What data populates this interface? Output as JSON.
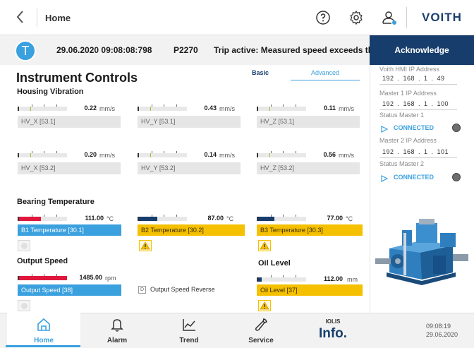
{
  "header": {
    "back_icon": "chevron-left-icon",
    "title": "Home",
    "brand": "VOITH"
  },
  "alarm": {
    "icon_letter": "T",
    "timestamp": "29.06.2020 09:08:08:798",
    "code": "P2270",
    "message": "Trip active: Measured speed exceeds th",
    "acknowledge_label": "Acknowledge"
  },
  "page": {
    "title": "Instrument Controls",
    "tabs": {
      "basic": "Basic",
      "advanced": "Advanced",
      "active": "Advanced"
    }
  },
  "vibration": {
    "title": "Housing Vibration",
    "sensors": [
      {
        "value": "0.22",
        "unit": "mm/s",
        "tag": "HV_X [53.1]"
      },
      {
        "value": "0.43",
        "unit": "mm/s",
        "tag": "HV_Y [53.1]"
      },
      {
        "value": "0.11",
        "unit": "mm/s",
        "tag": "HV_Z [53.1]"
      },
      {
        "value": "0.20",
        "unit": "mm/s",
        "tag": "HV_X [53.2]"
      },
      {
        "value": "0.14",
        "unit": "mm/s",
        "tag": "HV_Y [53.2]"
      },
      {
        "value": "0.56",
        "unit": "mm/s",
        "tag": "HV_Z [53.2]"
      }
    ]
  },
  "bearing": {
    "title": "Bearing Temperature",
    "sensors": [
      {
        "value": "111.00",
        "unit": "°C",
        "tag": "B1 Temperature [30.1]",
        "level": 0.45,
        "color": "#e0173c"
      },
      {
        "value": "87.00",
        "unit": "°C",
        "tag": "B2 Temperature [30.2]",
        "level": 0.38,
        "color": "#173d6c"
      },
      {
        "value": "77.00",
        "unit": "°C",
        "tag": "B3 Temperature [30.3]",
        "level": 0.34,
        "color": "#173d6c"
      }
    ]
  },
  "speed": {
    "title": "Output Speed",
    "value": "1485.00",
    "unit": "rpm",
    "tag": "Output Speed [38]",
    "level": 1.0,
    "reverse_label": "Output Speed Reverse",
    "reverse_box": "D"
  },
  "oil": {
    "title": "Oil Level",
    "value": "112.00",
    "unit": "mm",
    "tag": "Oil Level [37]"
  },
  "network": {
    "hmi_label": "Voith HMI IP Address",
    "hmi_ip": "192 . 168 .  1 .  49",
    "master1_label": "Master 1 IP Address",
    "master1_ip": "192 . 168 .  1 . 100",
    "status1_label": "Status Master 1",
    "status1_value": "CONNECTED",
    "master2_label": "Master 2 IP Address",
    "master2_ip": "192 . 168 .  1 . 101",
    "status2_label": "Status Master 2",
    "status2_value": "CONNECTED"
  },
  "nav": {
    "home": "Home",
    "alarm": "Alarm",
    "trend": "Trend",
    "service": "Service",
    "iolis_top": "IOLIS",
    "iolis_main": "Info."
  },
  "clock": {
    "time": "09:08:19",
    "date": "29.06.2020"
  },
  "colors": {
    "accent": "#3aa0de",
    "navy": "#173d6c",
    "warning": "#f5c000",
    "alarm_red": "#e0173c"
  }
}
